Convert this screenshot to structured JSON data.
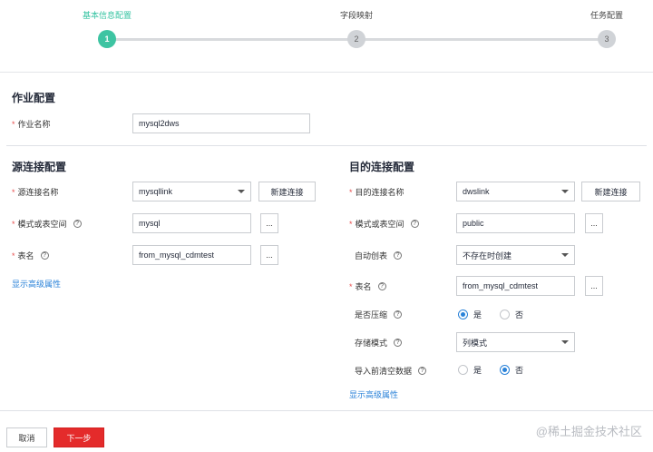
{
  "steps": [
    {
      "label": "基本信息配置",
      "number": "1",
      "active": true
    },
    {
      "label": "字段映射",
      "number": "2",
      "active": false
    },
    {
      "label": "任务配置",
      "number": "3",
      "active": false
    }
  ],
  "job": {
    "title": "作业配置",
    "name_label": "作业名称",
    "name_value": "mysql2dws"
  },
  "source": {
    "title": "源连接配置",
    "link_label": "源连接名称",
    "link_value": "mysqllink",
    "new_link_button": "新建连接",
    "schema_label": "模式或表空间",
    "schema_value": "mysql",
    "table_label": "表名",
    "table_value": "from_mysql_cdmtest",
    "browse": "...",
    "advanced_link": "显示高级属性"
  },
  "target": {
    "title": "目的连接配置",
    "link_label": "目的连接名称",
    "link_value": "dwslink",
    "new_link_button": "新建连接",
    "schema_label": "模式或表空间",
    "schema_value": "public",
    "auto_create_label": "自动创表",
    "auto_create_value": "不存在时创建",
    "table_label": "表名",
    "table_value": "from_mysql_cdmtest",
    "browse": "...",
    "compress_label": "是否压缩",
    "compress_yes": "是",
    "compress_no": "否",
    "compress_selected": "yes",
    "storage_label": "存储模式",
    "storage_value": "列模式",
    "clear_label": "导入前清空数据",
    "clear_yes": "是",
    "clear_no": "否",
    "clear_selected": "no",
    "advanced_link": "显示高级属性"
  },
  "footer": {
    "cancel_label": "取消",
    "next_label": "下一步"
  },
  "watermark": "@稀土掘金技术社区",
  "colors": {
    "step_active": "#3ec4a2",
    "primary_button": "#e42b2b",
    "link": "#2a82d8",
    "required": "#e84e4e"
  }
}
